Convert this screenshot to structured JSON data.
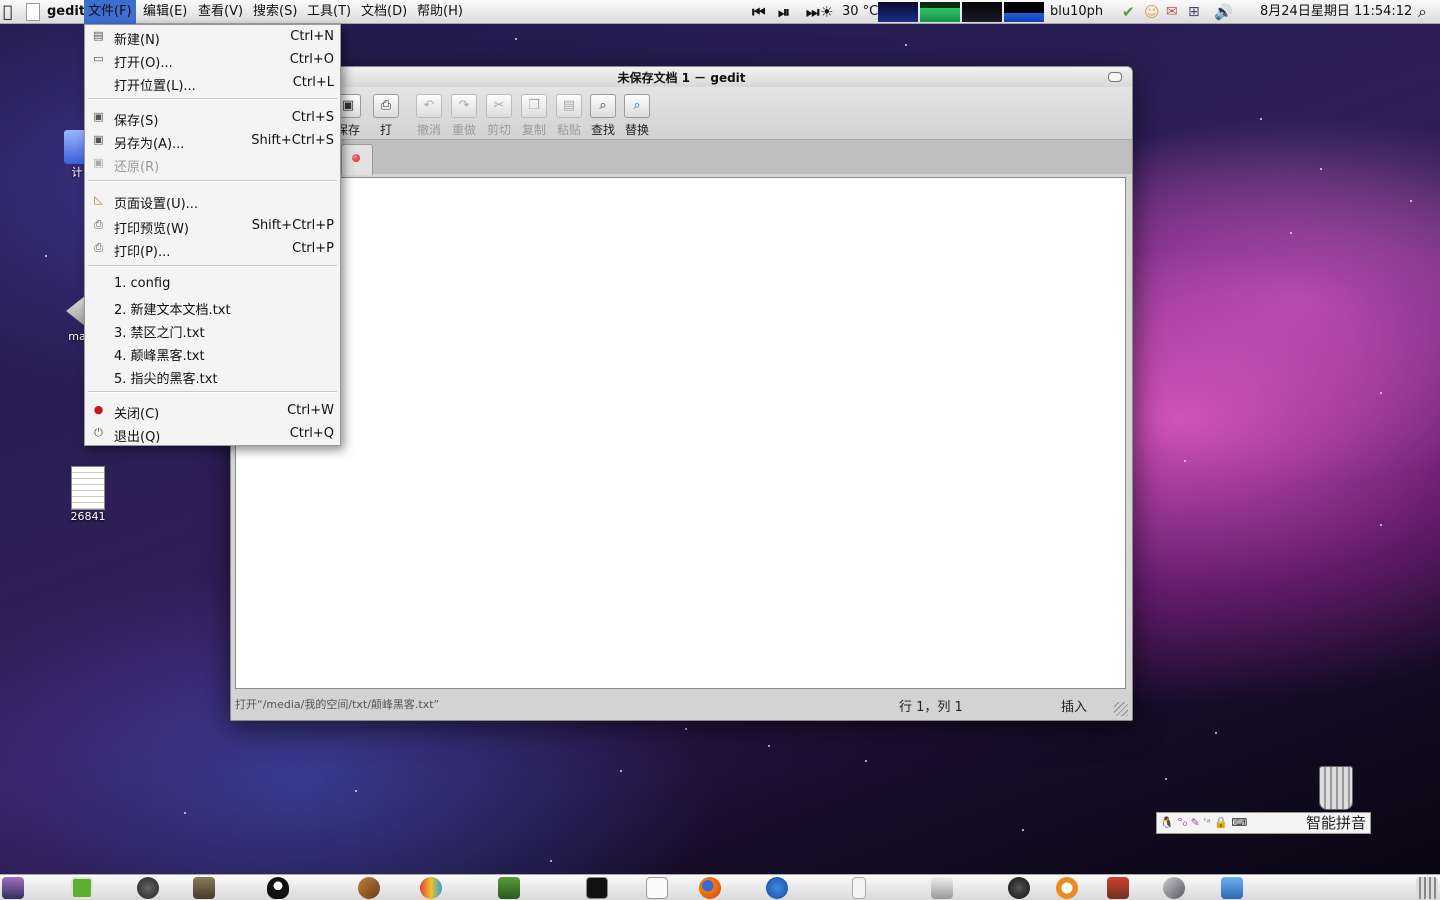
{
  "top_panel": {
    "app_name": "gedit",
    "menus": [
      "文件(F)",
      "编辑(E)",
      "查看(V)",
      "搜索(S)",
      "工具(T)",
      "文档(D)",
      "帮助(H)"
    ],
    "active_menu": "文件(F)",
    "weather": "30 °C",
    "username": "blu10ph",
    "clock": "8月24日星期日 11:54:12"
  },
  "window": {
    "title": "未保存文档 1 － gedit",
    "toolbar": [
      {
        "label": "保存",
        "icon": "save-icon",
        "enabled": true
      },
      {
        "label": "打印...",
        "icon": "print-icon",
        "enabled": true
      },
      {
        "label": "撤消",
        "icon": "undo-icon",
        "enabled": false
      },
      {
        "label": "重做",
        "icon": "redo-icon",
        "enabled": false
      },
      {
        "label": "剪切",
        "icon": "cut-icon",
        "enabled": false
      },
      {
        "label": "复制",
        "icon": "copy-icon",
        "enabled": false
      },
      {
        "label": "粘贴",
        "icon": "paste-icon",
        "enabled": false
      },
      {
        "label": "查找",
        "icon": "find-icon",
        "enabled": true
      },
      {
        "label": "替换",
        "icon": "replace-icon",
        "enabled": true
      }
    ],
    "statusbar": {
      "message": "打开“/media/我的空间/txt/颠峰黑客.txt”",
      "position": "行 1，列 1",
      "mode": "插入"
    }
  },
  "file_menu": {
    "items": [
      {
        "label": "新建(N)",
        "shortcut": "Ctrl+N",
        "icon": "new-document-icon"
      },
      {
        "label": "打开(O)...",
        "shortcut": "Ctrl+O",
        "icon": "open-icon"
      },
      {
        "label": "打开位置(L)...",
        "shortcut": "Ctrl+L",
        "icon": ""
      },
      {
        "label": "保存(S)",
        "shortcut": "Ctrl+S",
        "icon": "save-icon"
      },
      {
        "label": "另存为(A)...",
        "shortcut": "Shift+Ctrl+S",
        "icon": "save-as-icon"
      },
      {
        "label": "还原(R)",
        "shortcut": "",
        "icon": "revert-icon",
        "disabled": true
      },
      {
        "label": "页面设置(U)...",
        "shortcut": "",
        "icon": "page-setup-icon"
      },
      {
        "label": "打印预览(W)",
        "shortcut": "Shift+Ctrl+P",
        "icon": "print-preview-icon"
      },
      {
        "label": "打印(P)...",
        "shortcut": "Ctrl+P",
        "icon": "print-icon"
      },
      {
        "label": "1. config",
        "shortcut": ""
      },
      {
        "label": "2. 新建文本文档.txt",
        "shortcut": ""
      },
      {
        "label": "3. 禁区之门.txt",
        "shortcut": ""
      },
      {
        "label": "4. 颠峰黑客.txt",
        "shortcut": ""
      },
      {
        "label": "5. 指尖的黑客.txt",
        "shortcut": ""
      },
      {
        "label": "关闭(C)",
        "shortcut": "Ctrl+W",
        "icon": "close-icon"
      },
      {
        "label": "退出(Q)",
        "shortcut": "Ctrl+Q",
        "icon": "quit-icon"
      }
    ]
  },
  "desktop": {
    "icons": [
      {
        "label": "计",
        "icon": "computer-icon"
      },
      {
        "label": "ma",
        "icon": "folder-icon"
      },
      {
        "label": "26841",
        "icon": "text-file-icon"
      }
    ]
  },
  "ime": {
    "label": "智能拼音"
  },
  "colors": {
    "menu_highlight": "#3d6fd0",
    "close_red": "#c21818"
  }
}
